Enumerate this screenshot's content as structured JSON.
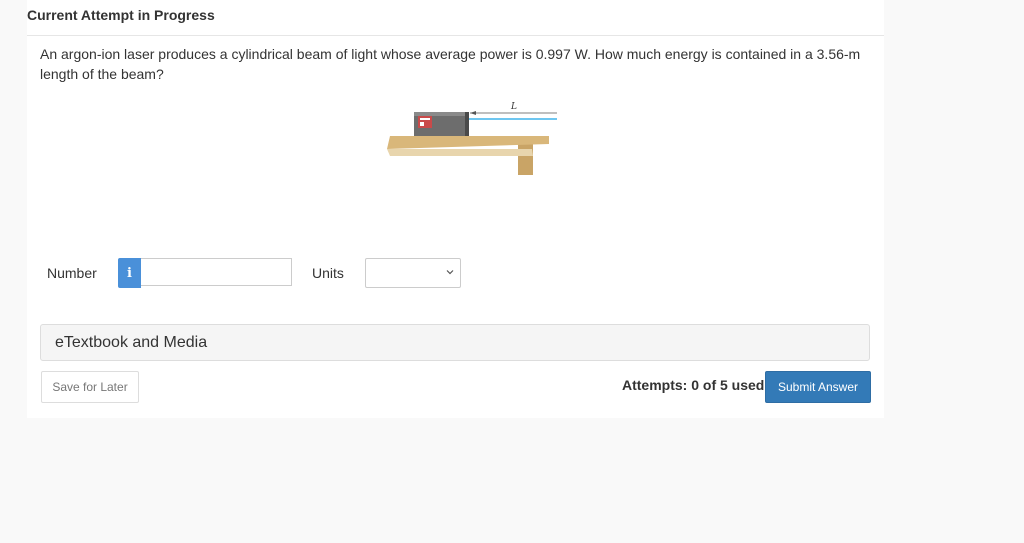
{
  "header": {
    "title": "Current Attempt in Progress"
  },
  "question": {
    "text": "An argon-ion laser produces a cylindrical beam of light whose average power is 0.997 W. How much energy is contained in a 3.56-m length of the beam?"
  },
  "figure": {
    "length_label": "L",
    "icon": "laser-on-table-illustration"
  },
  "answer": {
    "number_label": "Number",
    "info_icon": "i",
    "number_value": "",
    "units_label": "Units",
    "units_selected": ""
  },
  "resources": {
    "etextbook_label": "eTextbook and Media"
  },
  "footer": {
    "save_label": "Save for Later",
    "attempts_text": "Attempts: 0 of 5 used",
    "submit_label": "Submit Answer"
  },
  "colors": {
    "accent": "#337ab7",
    "info": "#4a90d9",
    "beam": "#6ec6f0",
    "table": "#d9b77a"
  }
}
